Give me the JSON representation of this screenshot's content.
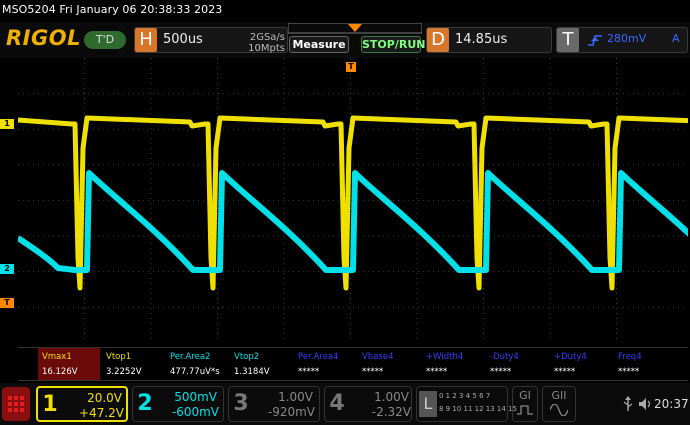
{
  "titlebar": {
    "text": "MSO5204  Fri January 06 20:38:33 2023"
  },
  "topbar": {
    "logo": "RIGOL",
    "trigger_state": "T'D",
    "horizontal": {
      "letter": "H",
      "timebase": "500us",
      "sample_rate": "2GSa/s",
      "memory": "10Mpts"
    },
    "measure_label": "Measure",
    "stop_run_label": "STOP/RUN",
    "delay": {
      "letter": "D",
      "value": "14.85us"
    },
    "trigger": {
      "letter": "T",
      "level": "280mV",
      "source_flag": "A",
      "slope_icon": "rising-edge-icon"
    }
  },
  "markers": {
    "ch1": "1",
    "ch2": "2",
    "trig": "T",
    "trig_top": "T"
  },
  "measurements": [
    {
      "label": "Vmax1",
      "value": "16.126V",
      "color": "#f0e000"
    },
    {
      "label": "Vtop1",
      "value": "3.2252V",
      "color": "#f0e000"
    },
    {
      "label": "Per.Area2",
      "value": "477.77uV*s",
      "color": "#00e0e8"
    },
    {
      "label": "Vtop2",
      "value": "1.3184V",
      "color": "#00e0e8"
    },
    {
      "label": "Per.Area4",
      "value": "*****",
      "color": "#3a3aff"
    },
    {
      "label": "Vbase4",
      "value": "*****",
      "color": "#3a3aff"
    },
    {
      "label": "+Width4",
      "value": "*****",
      "color": "#3a3aff"
    },
    {
      "label": "-Duty4",
      "value": "*****",
      "color": "#3a3aff"
    },
    {
      "label": "+Duty4",
      "value": "*****",
      "color": "#3a3aff"
    },
    {
      "label": "Freq4",
      "value": "*****",
      "color": "#3a3aff"
    }
  ],
  "channels": [
    {
      "num": "1",
      "scale": "20.0V",
      "offset": "+47.2V",
      "color": "#f0e000"
    },
    {
      "num": "2",
      "scale": "500mV",
      "offset": "-600mV",
      "color": "#00e0e8"
    },
    {
      "num": "3",
      "scale": "1.00V",
      "offset": "-920mV",
      "color": "#888888"
    },
    {
      "num": "4",
      "scale": "1.00V",
      "offset": "-2.32V",
      "color": "#888888"
    }
  ],
  "logic": {
    "letter": "L",
    "row1": "0 1 2 3 4 5 6 7",
    "row2": "8 9 10 11 12 13 14 15"
  },
  "decoders": {
    "g1": "GI",
    "g2": "GII"
  },
  "clock": "20:37",
  "colors": {
    "ch1": "#f0e000",
    "ch2": "#00e0e8",
    "trigger": "#ff8a00",
    "horizontal_accent": "#d8762a"
  }
}
